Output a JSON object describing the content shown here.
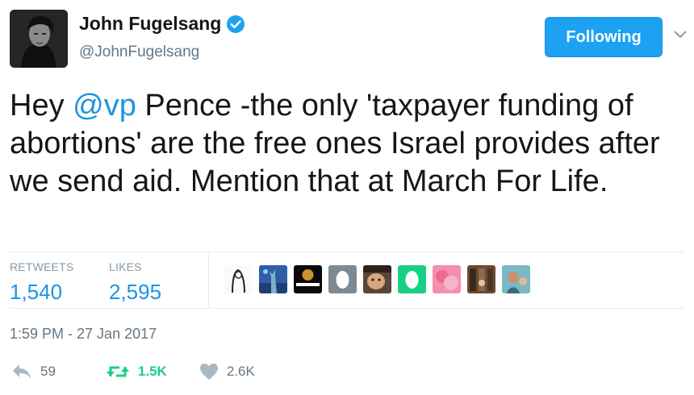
{
  "user": {
    "name": "John Fugelsang",
    "handle": "@JohnFugelsang",
    "follow_label": "Following"
  },
  "tweet": {
    "text_before": "Hey ",
    "mention": "@vp",
    "text_after": " Pence -the only 'taxpayer funding of abortions' are the free ones Israel provides after we send aid. Mention that at March For Life."
  },
  "stats": {
    "retweets_label": "RETWEETS",
    "retweets_value": "1,540",
    "likes_label": "LIKES",
    "likes_value": "2,595"
  },
  "timestamp": "1:59 PM - 27 Jan 2017",
  "actions": {
    "reply_count": "59",
    "retweet_count": "1.5K",
    "like_count": "2.6K"
  },
  "colors": {
    "accent": "#1da1f2",
    "link": "#1b95e0",
    "retweet_green": "#19cf86",
    "muted": "#657786"
  },
  "icons": [
    "verified-badge-icon",
    "chevron-down-icon",
    "reply-icon",
    "retweet-icon",
    "heart-icon"
  ]
}
